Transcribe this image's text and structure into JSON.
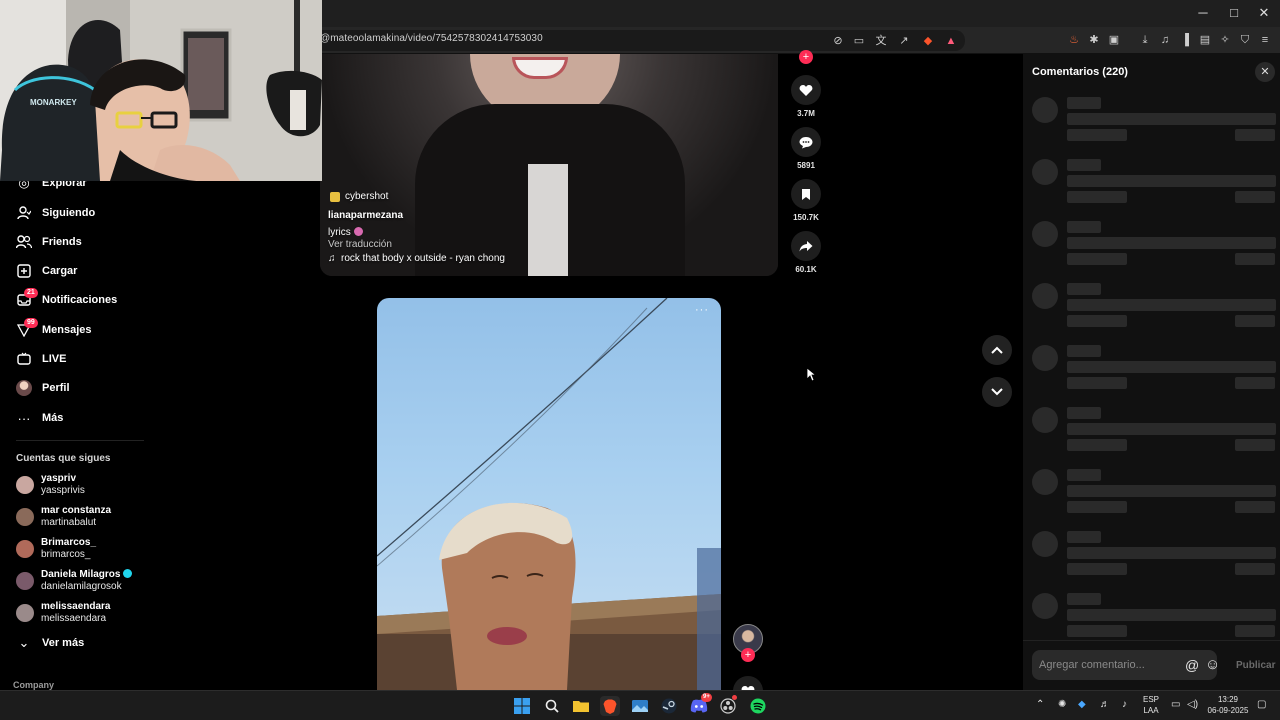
{
  "browser": {
    "url": "@mateoolamakina/video/7542578302414753030",
    "window_controls": {
      "minimize": "─",
      "maximize": "□",
      "close": "✕"
    }
  },
  "sidebar": {
    "nav": [
      {
        "label": "Explorar",
        "icon": "compass-icon"
      },
      {
        "label": "Siguiendo",
        "icon": "user-follow-icon"
      },
      {
        "label": "Friends",
        "icon": "friends-icon"
      },
      {
        "label": "Cargar",
        "icon": "upload-icon"
      },
      {
        "label": "Notificaciones",
        "icon": "inbox-icon",
        "badge": "21"
      },
      {
        "label": "Mensajes",
        "icon": "send-icon",
        "badge": "99"
      },
      {
        "label": "LIVE",
        "icon": "live-tv-icon"
      },
      {
        "label": "Perfil",
        "icon": "avatar-icon"
      },
      {
        "label": "Más",
        "icon": "more-icon",
        "glyph": "···"
      }
    ],
    "following_title": "Cuentas que sigues",
    "following": [
      {
        "name": "yaspriv",
        "handle": "yassprivis",
        "color": "#c9a7a0"
      },
      {
        "name": "mar constanza",
        "handle": "martinabalut",
        "color": "#8a6a5a"
      },
      {
        "name": "Brimarcos_",
        "handle": "brimarcos_",
        "color": "#b06a5a"
      },
      {
        "name": "Daniela Milagros",
        "handle": "danielamilagrosok",
        "color": "#7a5a6a",
        "verified": true
      },
      {
        "name": "melissaendara",
        "handle": "melissaendara",
        "color": "#9a8a8a"
      }
    ],
    "see_more": "Ver más",
    "company": "Company"
  },
  "video1": {
    "tag": "cybershot",
    "author": "lianaparmezana",
    "caption": "lyrics",
    "translate": "Ver traducción",
    "music": "rock that body x outside - ryan chong",
    "actions": {
      "likes": "3.7M",
      "comments": "5891",
      "saves": "150.7K",
      "shares": "60.1K"
    }
  },
  "video2": {
    "more_glyph": "···"
  },
  "comments": {
    "title": "Comentarios (220)",
    "close": "✕",
    "skeleton_count": 9,
    "input_placeholder": "Agregar comentario...",
    "at": "@",
    "emoji": "☺",
    "publish": "Publicar"
  },
  "taskbar": {
    "lang_1": "ESP",
    "lang_2": "LAA",
    "time": "13:29",
    "date": "06-09-2025",
    "discord_badge": "9+"
  },
  "colors": {
    "accent_pink": "#fe2c55",
    "panel_bg": "#111111",
    "skeleton": "#2a2a2a"
  }
}
